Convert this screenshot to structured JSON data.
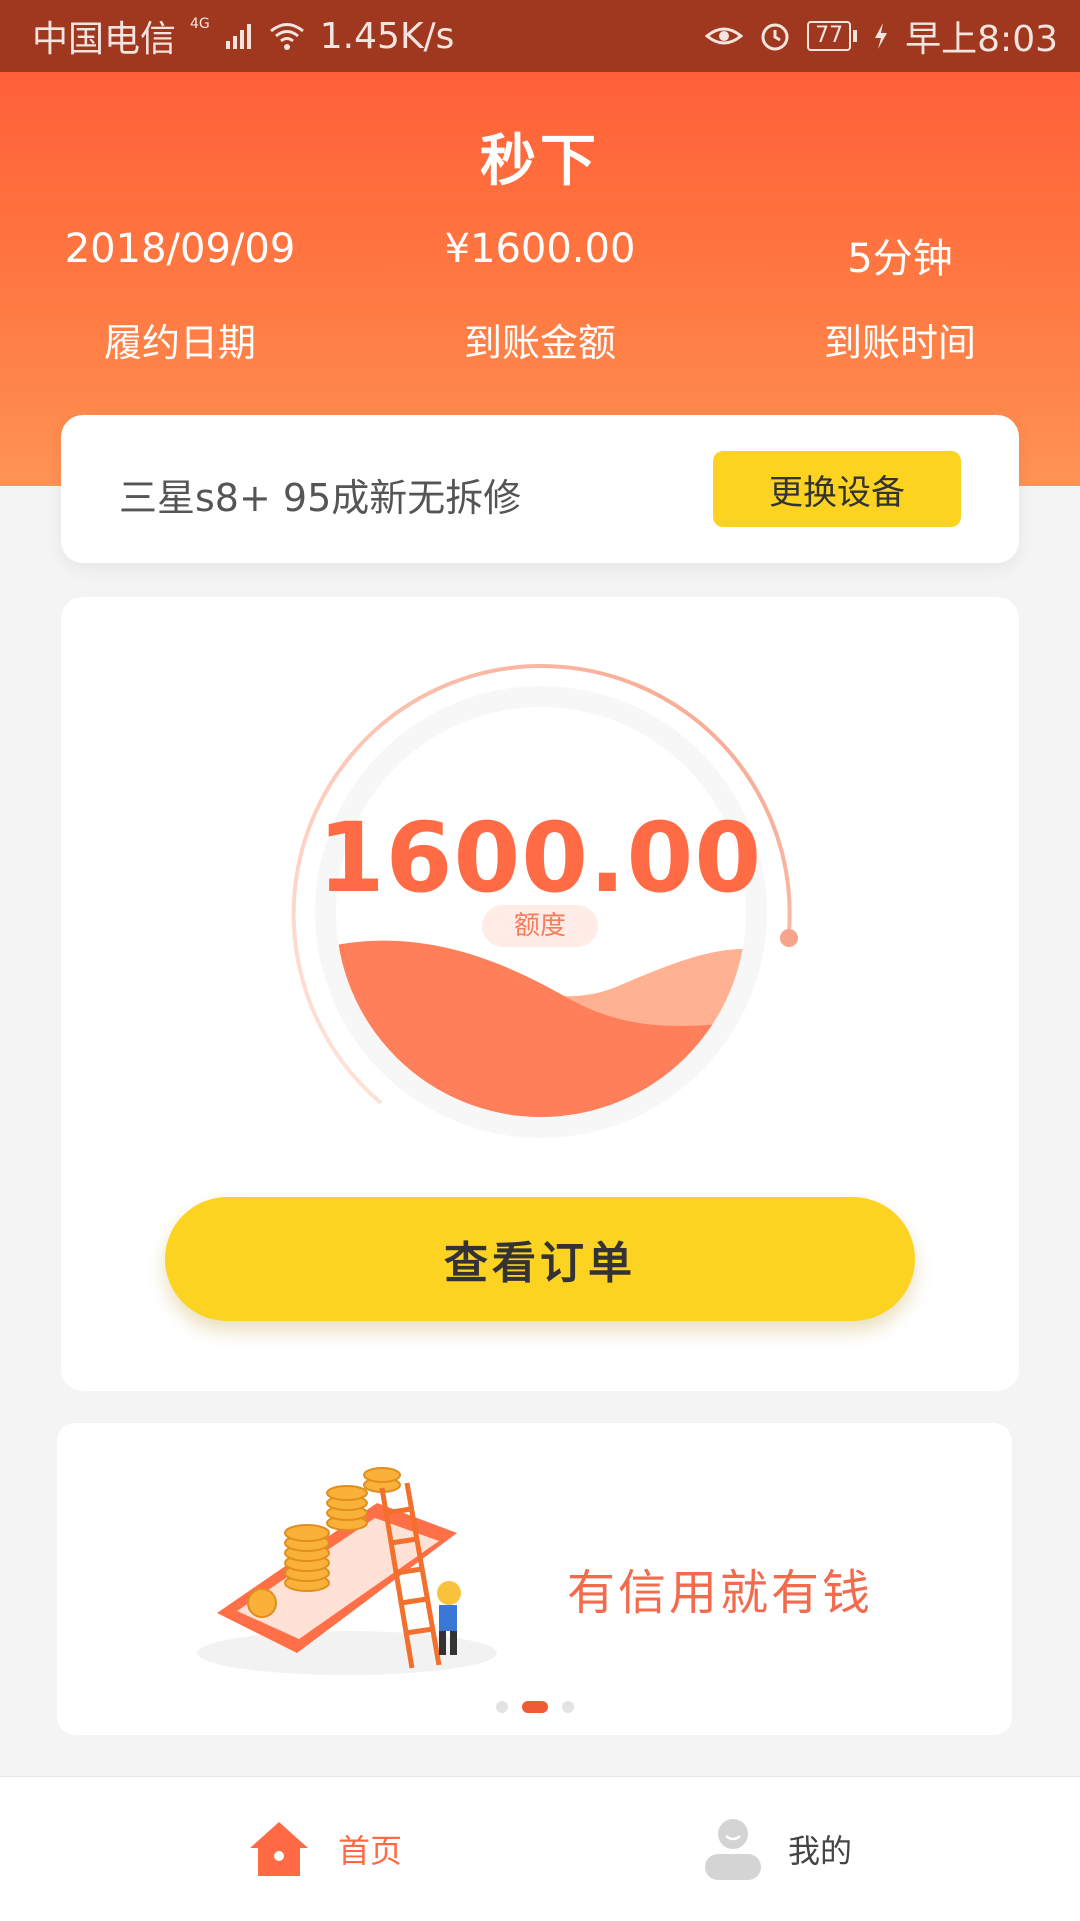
{
  "status_bar": {
    "carrier": "中国电信",
    "network": "4G",
    "speed": "1.45K/s",
    "battery": "77",
    "time": "早上8:03"
  },
  "header": {
    "title": "秒下",
    "stats": [
      {
        "value": "2018/09/09",
        "label": "履约日期"
      },
      {
        "value": "¥1600.00",
        "label": "到账金额"
      },
      {
        "value": "5分钟",
        "label": "到账时间"
      }
    ]
  },
  "device": {
    "name": "三星s8+ 95成新无拆修",
    "change_label": "更换设备"
  },
  "credit": {
    "amount": "1600.00",
    "badge": "额度",
    "view_orders_label": "查看订单"
  },
  "banner": {
    "slogan": "有信用就有钱",
    "active_index": 1,
    "slide_count": 3
  },
  "bottom_nav": {
    "items": [
      {
        "label": "首页",
        "icon": "home-icon",
        "active": true
      },
      {
        "label": "我的",
        "icon": "user-icon",
        "active": false
      }
    ]
  },
  "colors": {
    "accent": "#ff6b45",
    "button_yellow": "#fdd322",
    "status_bar": "#a0381f"
  }
}
